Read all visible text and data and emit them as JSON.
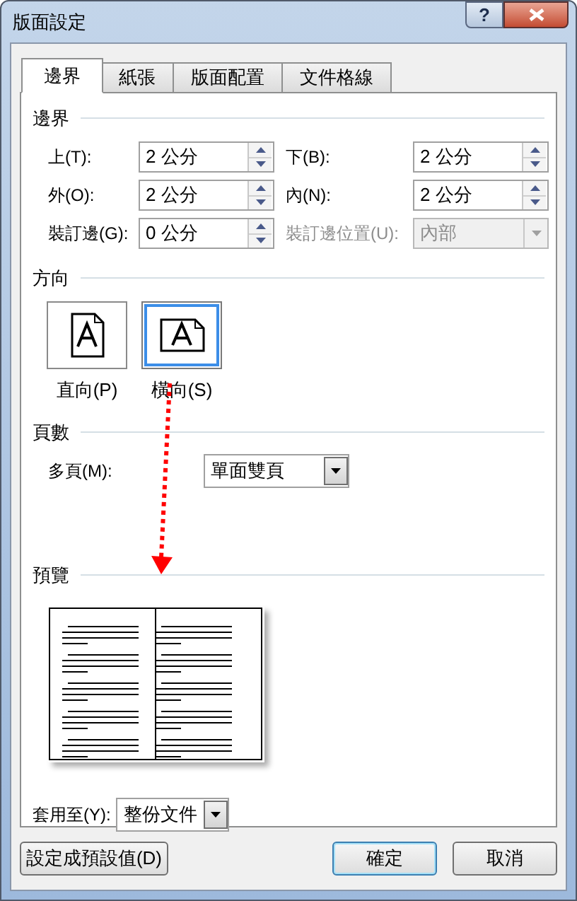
{
  "window": {
    "title": "版面設定",
    "help": "?"
  },
  "tabs": [
    {
      "label": "邊界",
      "selected": true
    },
    {
      "label": "紙張",
      "selected": false
    },
    {
      "label": "版面配置",
      "selected": false
    },
    {
      "label": "文件格線",
      "selected": false
    }
  ],
  "margins": {
    "title": "邊界",
    "fields": [
      {
        "label": "上(T):",
        "value": "2 公分"
      },
      {
        "label": "下(B):",
        "value": "2 公分"
      },
      {
        "label": "外(O):",
        "value": "2 公分"
      },
      {
        "label": "內(N):",
        "value": "2 公分"
      },
      {
        "label": "裝訂邊(G):",
        "value": "0 公分"
      }
    ],
    "gutter_position": {
      "label": "裝訂邊位置(U):",
      "value": "內部",
      "disabled": true
    }
  },
  "orientation": {
    "title": "方向",
    "options": [
      {
        "label": "直向(P)",
        "kind": "portrait",
        "selected": false
      },
      {
        "label": "橫向(S)",
        "kind": "landscape",
        "selected": true
      }
    ]
  },
  "pages": {
    "title": "頁數",
    "multiple_pages": {
      "label": "多頁(M):",
      "value": "單面雙頁"
    }
  },
  "preview": {
    "title": "預覽"
  },
  "apply_to": {
    "label": "套用至(Y):",
    "value": "整份文件"
  },
  "buttons": [
    {
      "label": "設定成預設值(D)",
      "default": false
    },
    {
      "label": "確定",
      "default": true
    },
    {
      "label": "取消",
      "default": false
    }
  ]
}
